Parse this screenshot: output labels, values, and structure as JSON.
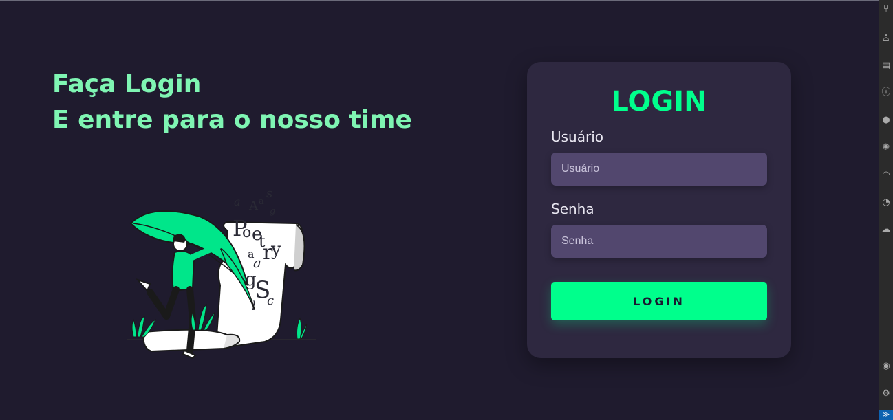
{
  "hero": {
    "line1": "Faça Login",
    "line2": "E entre para o nosso time"
  },
  "illustration": {
    "letters": [
      "a",
      "A",
      "a",
      "s",
      "g",
      "P",
      "o",
      "e",
      "t",
      "r",
      "y",
      "a",
      "a",
      "g",
      "S",
      "c",
      "l"
    ]
  },
  "login_card": {
    "title": "LOGIN",
    "username_label": "Usuário",
    "username_placeholder": "Usuário",
    "password_label": "Senha",
    "password_placeholder": "Senha",
    "submit_label": "LOGIN"
  },
  "colors": {
    "background": "#1f1b2e",
    "card": "#2e2840",
    "accent": "#00ff8c",
    "heading": "#7ff5b3",
    "input": "#52476e"
  },
  "sidebar": {
    "icons": [
      "branch-icon",
      "extensions-icon",
      "layout-icon",
      "info-icon",
      "github-icon",
      "settings-icon",
      "wifi-icon",
      "timeline-icon",
      "cloud-icon",
      "account-icon",
      "gear-icon",
      "remote-icon"
    ]
  }
}
